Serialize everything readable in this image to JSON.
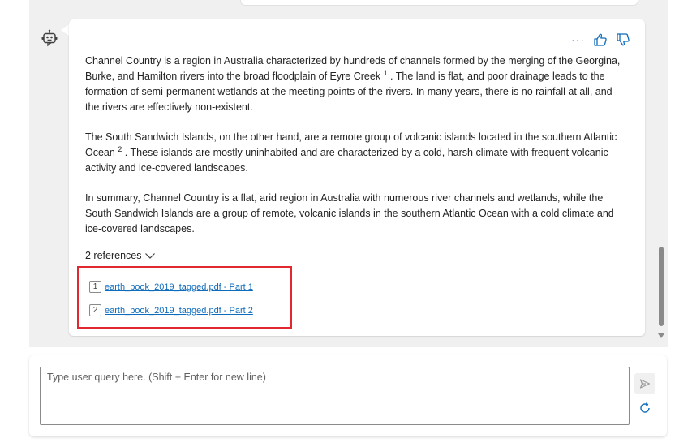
{
  "message": {
    "paragraphs": [
      {
        "before": "Channel Country is a region in Australia characterized by hundreds of channels formed by the merging of the Georgina, Burke, and Hamilton rivers into the broad floodplain of Eyre Creek ",
        "citation": "1",
        "after": " . The land is flat, and poor drainage leads to the formation of semi-permanent wetlands at the meeting points of the rivers. In many years, there is no rainfall at all, and the rivers are effectively non-existent."
      },
      {
        "before": "The South Sandwich Islands, on the other hand, are a remote group of volcanic islands located in the southern Atlantic Ocean ",
        "citation": "2",
        "after": " . These islands are mostly uninhabited and are characterized by a cold, harsh climate with frequent volcanic activity and ice-covered landscapes."
      },
      {
        "before": "In summary, Channel Country is a flat, arid region in Australia with numerous river channels and wetlands, while the South Sandwich Islands are a group of remote, volcanic islands in the southern Atlantic Ocean with a cold climate and ice-covered landscapes.",
        "citation": "",
        "after": ""
      }
    ],
    "actions": {
      "more_label": "···"
    },
    "references_toggle": "2 references",
    "references": [
      {
        "num": "1",
        "label": "earth_book_2019_tagged.pdf - Part 1"
      },
      {
        "num": "2",
        "label": "earth_book_2019_tagged.pdf - Part 2"
      }
    ]
  },
  "composer": {
    "placeholder": "Type user query here. (Shift + Enter for new line)",
    "value": ""
  },
  "icons": {
    "avatar": "bot-icon",
    "like": "thumbs-up-icon",
    "dislike": "thumbs-down-icon",
    "toggle": "chevron-down-icon",
    "send": "send-icon",
    "refresh": "refresh-icon"
  },
  "colors": {
    "accent": "#0f6cbd",
    "highlight_border": "#e0282e",
    "chat_background": "#f0f0f0"
  }
}
